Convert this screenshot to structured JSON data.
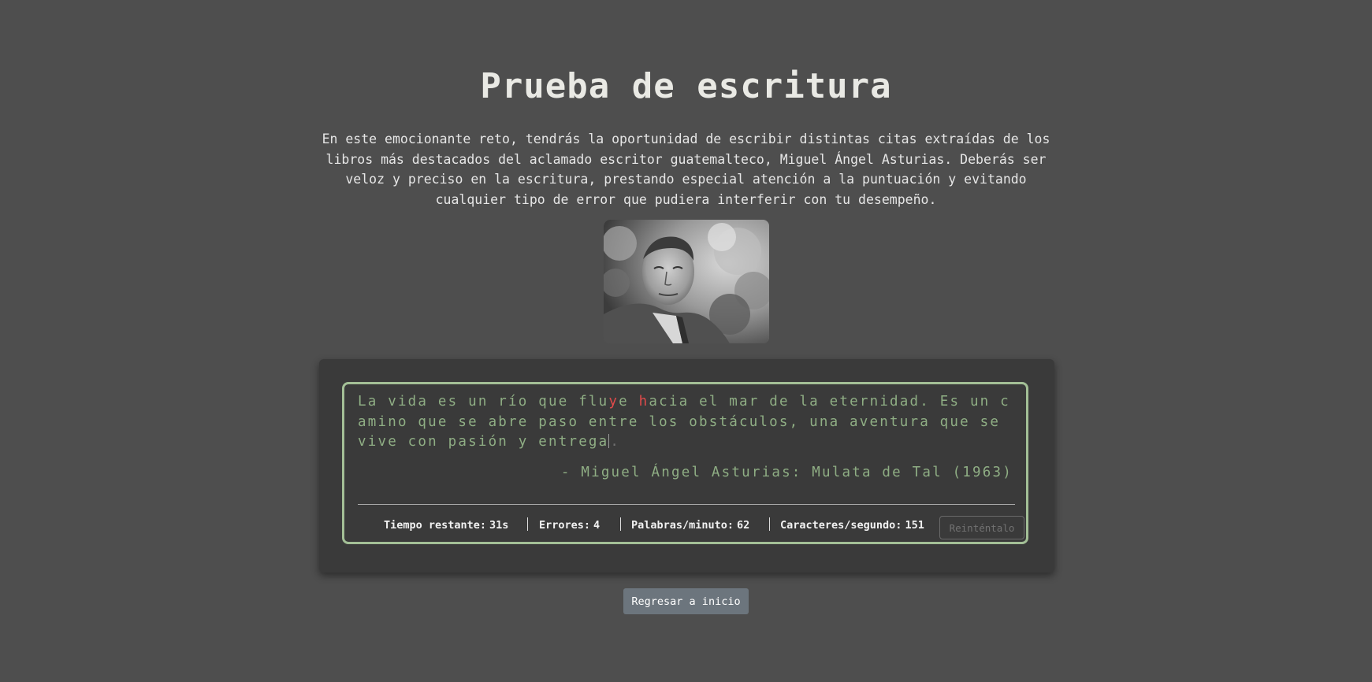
{
  "page": {
    "title": "Prueba de escritura",
    "intro": "En este emocionante reto, tendrás la oportunidad de escribir distintas citas extraídas de los libros más destacados del aclamado escritor guatemalteco, Miguel Ángel Asturias. Deberás ser veloz y preciso en la escritura, prestando especial atención a la puntuación y evitando cualquier tipo de error que pudiera interferir con tu desempeño."
  },
  "portrait": {
    "subject": "Miguel Ángel Asturias"
  },
  "quote": {
    "seg1": "La vida es un río que flu",
    "err1": "y",
    "seg2": "e ",
    "err2": "h",
    "seg3": "acia el mar de la eternidad. Es un camino que se abre paso entre los obstáculos, una aventura que se vive con pasión y entrega",
    "remaining": ".",
    "attribution": "- Miguel Ángel Asturias: Mulata de Tal (1963)"
  },
  "stats": {
    "time_label": "Tiempo restante:",
    "time_value": "31s",
    "errors_label": "Errores:",
    "errors_value": "4",
    "wpm_label": "Palabras/minuto:",
    "wpm_value": "62",
    "cps_label": "Caracteres/segundo:",
    "cps_value": "151"
  },
  "buttons": {
    "retry": "Reinténtalo",
    "home": "Regresar a inicio"
  },
  "colors": {
    "background": "#4e4e4e",
    "card": "#3a3a3a",
    "accent_border": "#a3bf96",
    "quote_text": "#8fae84",
    "error": "#e14b4b",
    "home_button": "#6c757d"
  }
}
